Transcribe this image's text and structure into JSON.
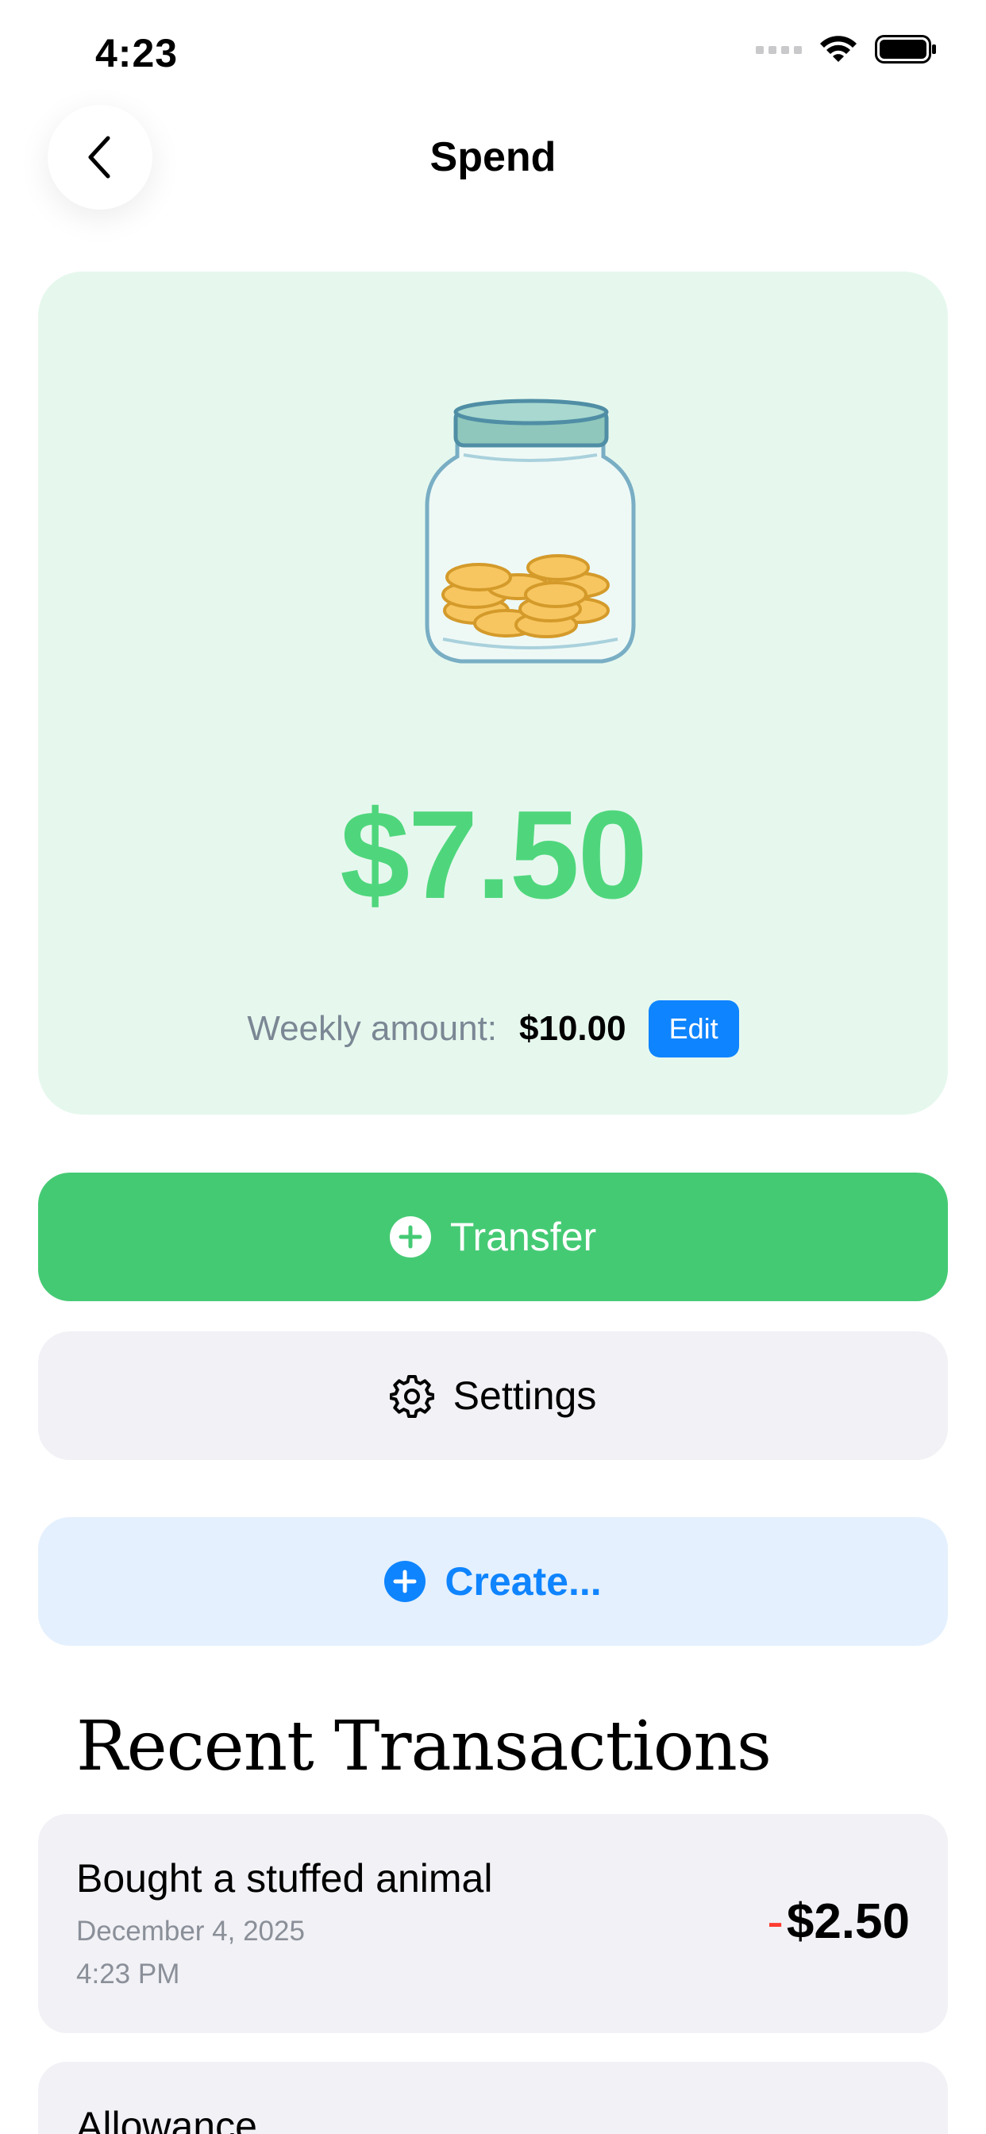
{
  "status_bar": {
    "time": "4:23"
  },
  "nav": {
    "title": "Spend"
  },
  "balance_card": {
    "balance": "$7.50",
    "weekly_label": "Weekly amount:",
    "weekly_value": "$10.00",
    "edit_label": "Edit"
  },
  "actions": {
    "transfer_label": "Transfer",
    "settings_label": "Settings",
    "create_label": "Create..."
  },
  "recent": {
    "title": "Recent Transactions",
    "items": [
      {
        "title": "Bought a stuffed animal",
        "date": "December 4, 2025",
        "time": "4:23 PM",
        "sign": "-",
        "amount": "$2.50"
      },
      {
        "title": "Allowance"
      }
    ]
  },
  "colors": {
    "accent_green": "#45ca74",
    "balance_green": "#4fd67c",
    "accent_blue": "#0f84ff",
    "negative_red": "#ff3b30"
  }
}
